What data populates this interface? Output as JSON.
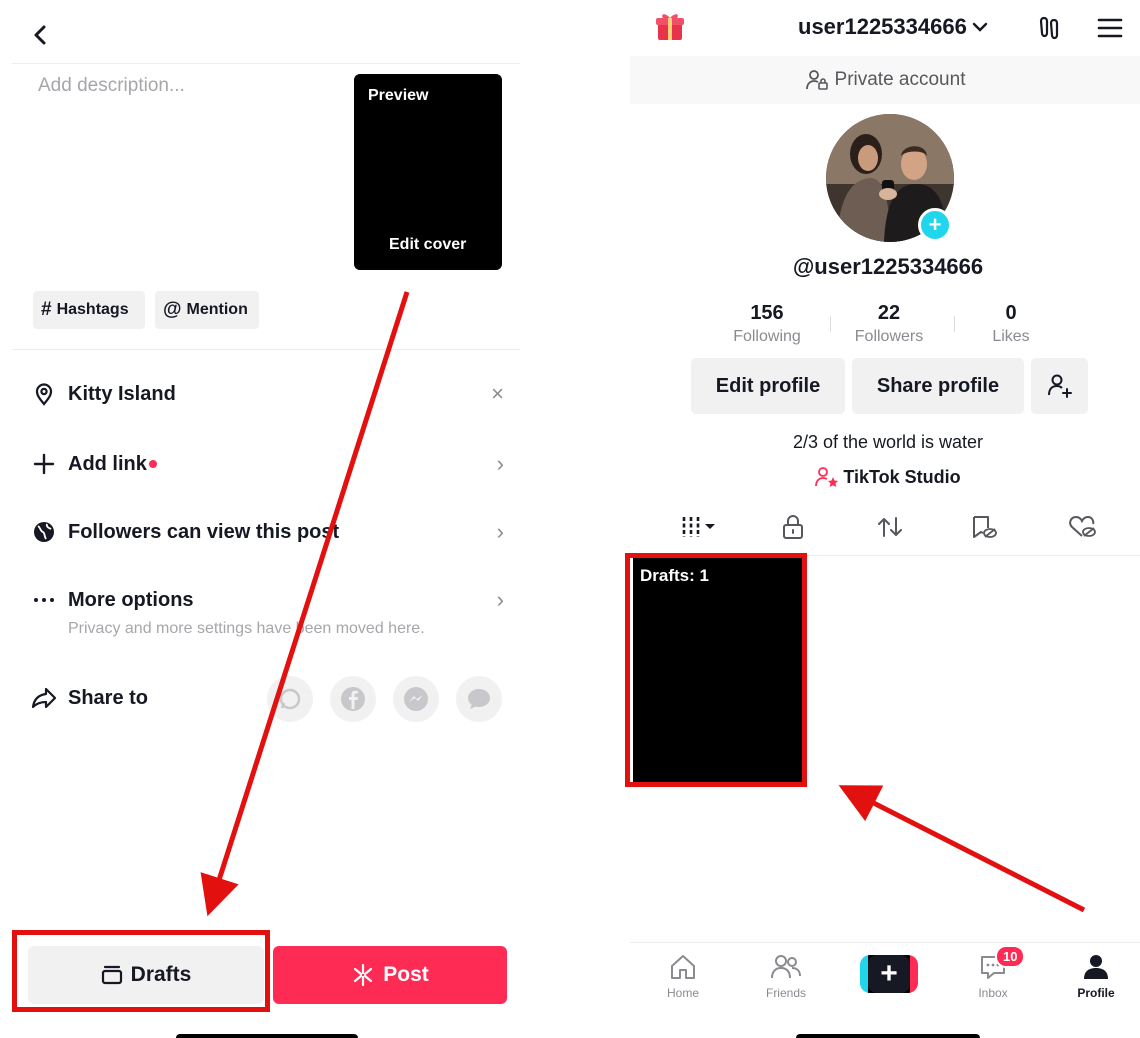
{
  "left": {
    "description_placeholder": "Add description...",
    "cover": {
      "preview_label": "Preview",
      "edit_cover_label": "Edit cover"
    },
    "chips": [
      {
        "symbol": "#",
        "label": "Hashtags"
      },
      {
        "symbol": "@",
        "label": "Mention"
      }
    ],
    "location": {
      "label": "Kitty Island",
      "end": "×"
    },
    "add_link": {
      "label": "Add link",
      "end": "›"
    },
    "privacy": {
      "label": "Followers can view this post",
      "end": "›"
    },
    "more": {
      "label": "More options",
      "sub": "Privacy and more settings have been moved here.",
      "end": "›"
    },
    "share_to": {
      "label": "Share to",
      "targets": [
        "whatsapp-icon",
        "facebook-icon",
        "messenger-icon",
        "sms-icon"
      ]
    },
    "drafts_label": "Drafts",
    "post_label": "Post"
  },
  "right": {
    "username": "user1225334666",
    "private_label": "Private account",
    "handle": "@user1225334666",
    "stats": [
      {
        "value": "156",
        "label": "Following"
      },
      {
        "value": "22",
        "label": "Followers"
      },
      {
        "value": "0",
        "label": "Likes"
      }
    ],
    "edit_profile": "Edit profile",
    "share_profile": "Share profile",
    "bio": "2/3 of the world is water",
    "studio": "TikTok Studio",
    "drafts_tile": "Drafts: 1",
    "nav": [
      {
        "label": "Home"
      },
      {
        "label": "Friends"
      },
      {
        "label": ""
      },
      {
        "label": "Inbox",
        "badge": "10"
      },
      {
        "label": "Profile"
      }
    ]
  },
  "colors": {
    "accent": "#fe2c55",
    "teal": "#20d5ec",
    "annotation": "#e31010"
  }
}
